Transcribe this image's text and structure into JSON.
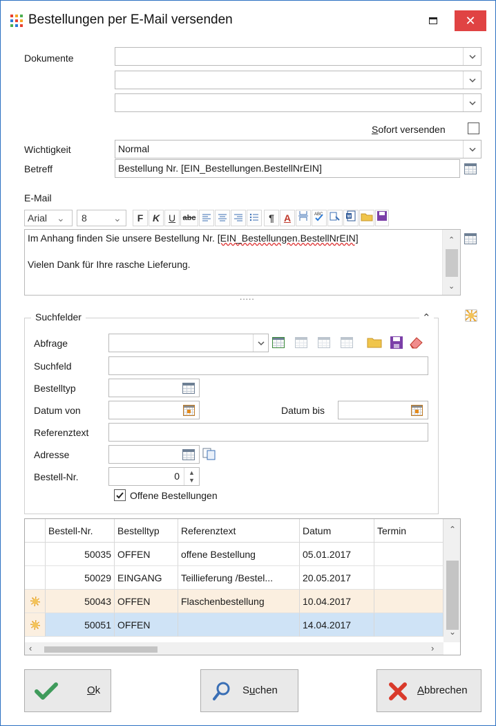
{
  "window": {
    "title": "Bestellungen per E-Mail versenden",
    "close_glyph": "✕"
  },
  "dokumente": {
    "label": "Dokumente",
    "values": [
      "",
      "",
      ""
    ]
  },
  "sofort": {
    "label_accesskey": "S",
    "label_rest": "ofort versenden",
    "checked": false
  },
  "wichtigkeit": {
    "label": "Wichtigkeit",
    "value": "Normal"
  },
  "betreff": {
    "label": "Betreff",
    "value": "Bestellung Nr. [EIN_Bestellungen.BestellNrEIN]"
  },
  "email": {
    "label": "E-Mail",
    "font": "Arial",
    "size": "8",
    "toolbar": [
      "F",
      "K",
      "U",
      "abc",
      "¶",
      "A"
    ],
    "body_line1_prefix": "Im Anhang finden Sie unsere Bestellung Nr. ",
    "body_line1_field": "[EIN_Bestellungen.BestellNrEIN]",
    "body_line2": "Vielen Dank für Ihre rasche Lieferung.",
    "splitter": "....."
  },
  "suchfelder": {
    "title": "Suchfelder",
    "abfrage_label": "Abfrage",
    "suchfeld_label": "Suchfeld",
    "bestelltyp_label": "Bestelltyp",
    "datum_von_label": "Datum von",
    "datum_bis_label": "Datum bis",
    "referenztext_label": "Referenztext",
    "adresse_label": "Adresse",
    "bestellnr_label": "Bestell-Nr.",
    "bestellnr_value": "0",
    "offene_label": "Offene Bestellungen",
    "offene_checked": true
  },
  "grid": {
    "columns": [
      "Bestell-Nr.",
      "Bestelltyp",
      "Referenztext",
      "Datum",
      "Termin"
    ],
    "rows": [
      {
        "nr": "50035",
        "typ": "OFFEN",
        "ref": "offene Bestellung",
        "datum": "05.01.2017",
        "termin": "",
        "new": false,
        "state": "normal"
      },
      {
        "nr": "50029",
        "typ": "EINGANG",
        "ref": "Teillieferung /Bestel...",
        "datum": "20.05.2017",
        "termin": "",
        "new": false,
        "state": "normal"
      },
      {
        "nr": "50043",
        "typ": "OFFEN",
        "ref": "Flaschenbestellung",
        "datum": "10.04.2017",
        "termin": "",
        "new": true,
        "state": "highlight"
      },
      {
        "nr": "50051",
        "typ": "OFFEN",
        "ref": "",
        "datum": "14.04.2017",
        "termin": "",
        "new": true,
        "state": "selected"
      }
    ]
  },
  "buttons": {
    "ok_accesskey": "O",
    "ok_rest": "k",
    "suchen_first": "S",
    "suchen_accesskey": "u",
    "suchen_rest": "chen",
    "abbrechen_accesskey": "A",
    "abbrechen_rest": "bbrechen"
  },
  "colors": {
    "accent": "#2b6fc1",
    "close": "#e04343",
    "row_highlight": "#fbefe0",
    "row_selected": "#cfe3f6",
    "ok_check": "#3f9b5b",
    "cancel_x": "#d93a2b",
    "search_icon": "#3a6fb5"
  }
}
